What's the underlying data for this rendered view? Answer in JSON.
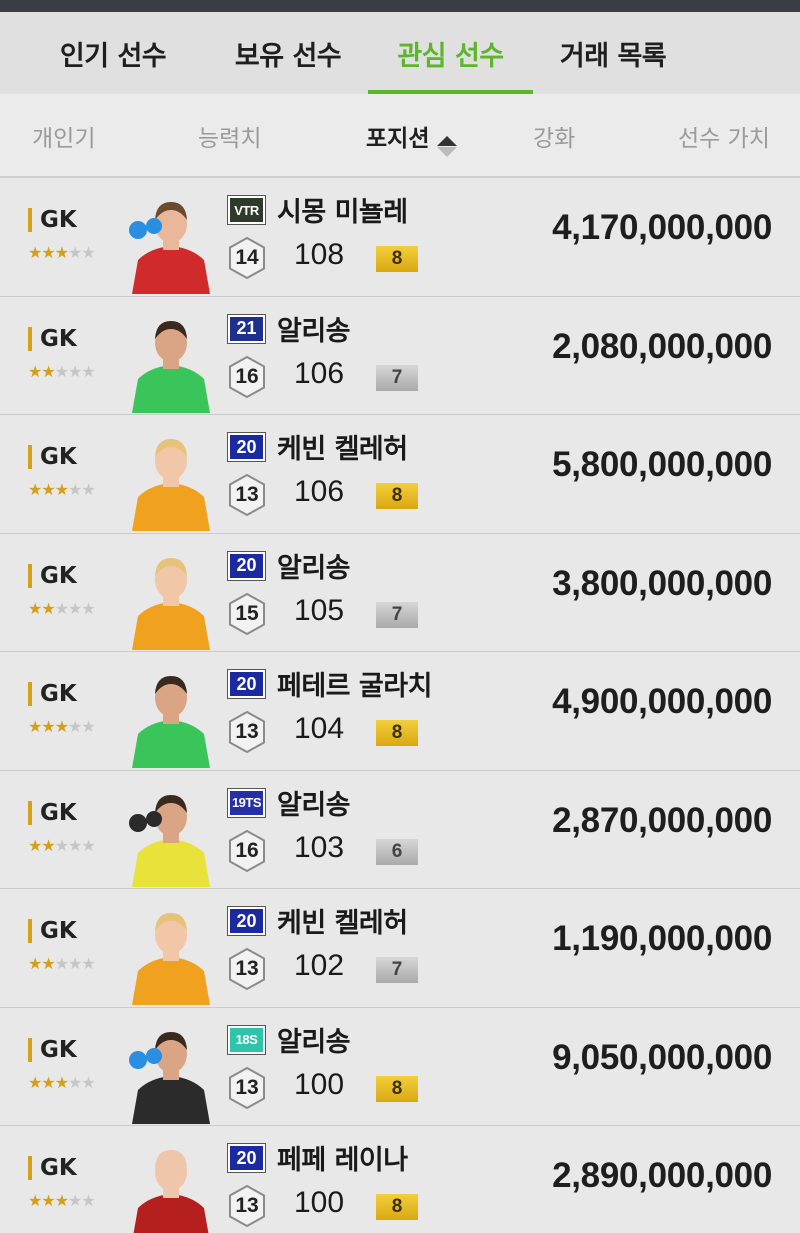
{
  "tabs": [
    {
      "label": "인기 선수",
      "active": false
    },
    {
      "label": "보유 선수",
      "active": false
    },
    {
      "label": "관심 선수",
      "active": true
    },
    {
      "label": "거래 목록",
      "active": false
    }
  ],
  "sort": {
    "popularity": "개인기",
    "ability": "능력치",
    "position": "포지션",
    "enhance": "강화",
    "value": "선수 가치",
    "active_key": "position",
    "direction": "ascending"
  },
  "colors": {
    "accent_green": "#5cb52a",
    "position_gold": "#d4a017",
    "grade_gold": "#e9bd20",
    "grade_silver": "#bdbdbd"
  },
  "players": [
    {
      "position": "GK",
      "stars": 3,
      "season": "VTR",
      "season_color": "#2e3a2a",
      "name": "시몽 미뇰레",
      "level": "14",
      "ovr": "108",
      "grade": "8",
      "grade_type": "gold",
      "value": "4,170,000,000",
      "photo": "keeper-red-gloves"
    },
    {
      "position": "GK",
      "stars": 2,
      "season": "21",
      "season_color": "#1e2f8c",
      "name": "알리송",
      "level": "16",
      "ovr": "106",
      "grade": "7",
      "grade_type": "silver",
      "value": "2,080,000,000",
      "photo": "keeper-green-kit"
    },
    {
      "position": "GK",
      "stars": 3,
      "season": "20",
      "season_color": "#1b2aa0",
      "name": "케빈 켈레허",
      "level": "13",
      "ovr": "106",
      "grade": "8",
      "grade_type": "gold",
      "value": "5,800,000,000",
      "photo": "keeper-orange-kit"
    },
    {
      "position": "GK",
      "stars": 2,
      "season": "20",
      "season_color": "#1b2aa0",
      "name": "알리송",
      "level": "15",
      "ovr": "105",
      "grade": "7",
      "grade_type": "silver",
      "value": "3,800,000,000",
      "photo": "keeper-orange-kit"
    },
    {
      "position": "GK",
      "stars": 3,
      "season": "20",
      "season_color": "#1b2aa0",
      "name": "페테르 굴라치",
      "level": "13",
      "ovr": "104",
      "grade": "8",
      "grade_type": "gold",
      "value": "4,900,000,000",
      "photo": "keeper-green-kit"
    },
    {
      "position": "GK",
      "stars": 2,
      "season": "19TS",
      "season_color": "#2530a8",
      "name": "알리송",
      "level": "16",
      "ovr": "103",
      "grade": "6",
      "grade_type": "silver",
      "value": "2,870,000,000",
      "photo": "keeper-yellow-kit"
    },
    {
      "position": "GK",
      "stars": 2,
      "season": "20",
      "season_color": "#1b2aa0",
      "name": "케빈 켈레허",
      "level": "13",
      "ovr": "102",
      "grade": "7",
      "grade_type": "silver",
      "value": "1,190,000,000",
      "photo": "keeper-orange-kit"
    },
    {
      "position": "GK",
      "stars": 3,
      "season": "18S",
      "season_color": "#2fc4a9",
      "name": "알리송",
      "level": "13",
      "ovr": "100",
      "grade": "8",
      "grade_type": "gold",
      "value": "9,050,000,000",
      "photo": "keeper-black-kit"
    },
    {
      "position": "GK",
      "stars": 3,
      "season": "20",
      "season_color": "#1b2aa0",
      "name": "페페 레이나",
      "level": "13",
      "ovr": "100",
      "grade": "8",
      "grade_type": "gold",
      "value": "2,890,000,000",
      "photo": "keeper-red-kit"
    }
  ]
}
